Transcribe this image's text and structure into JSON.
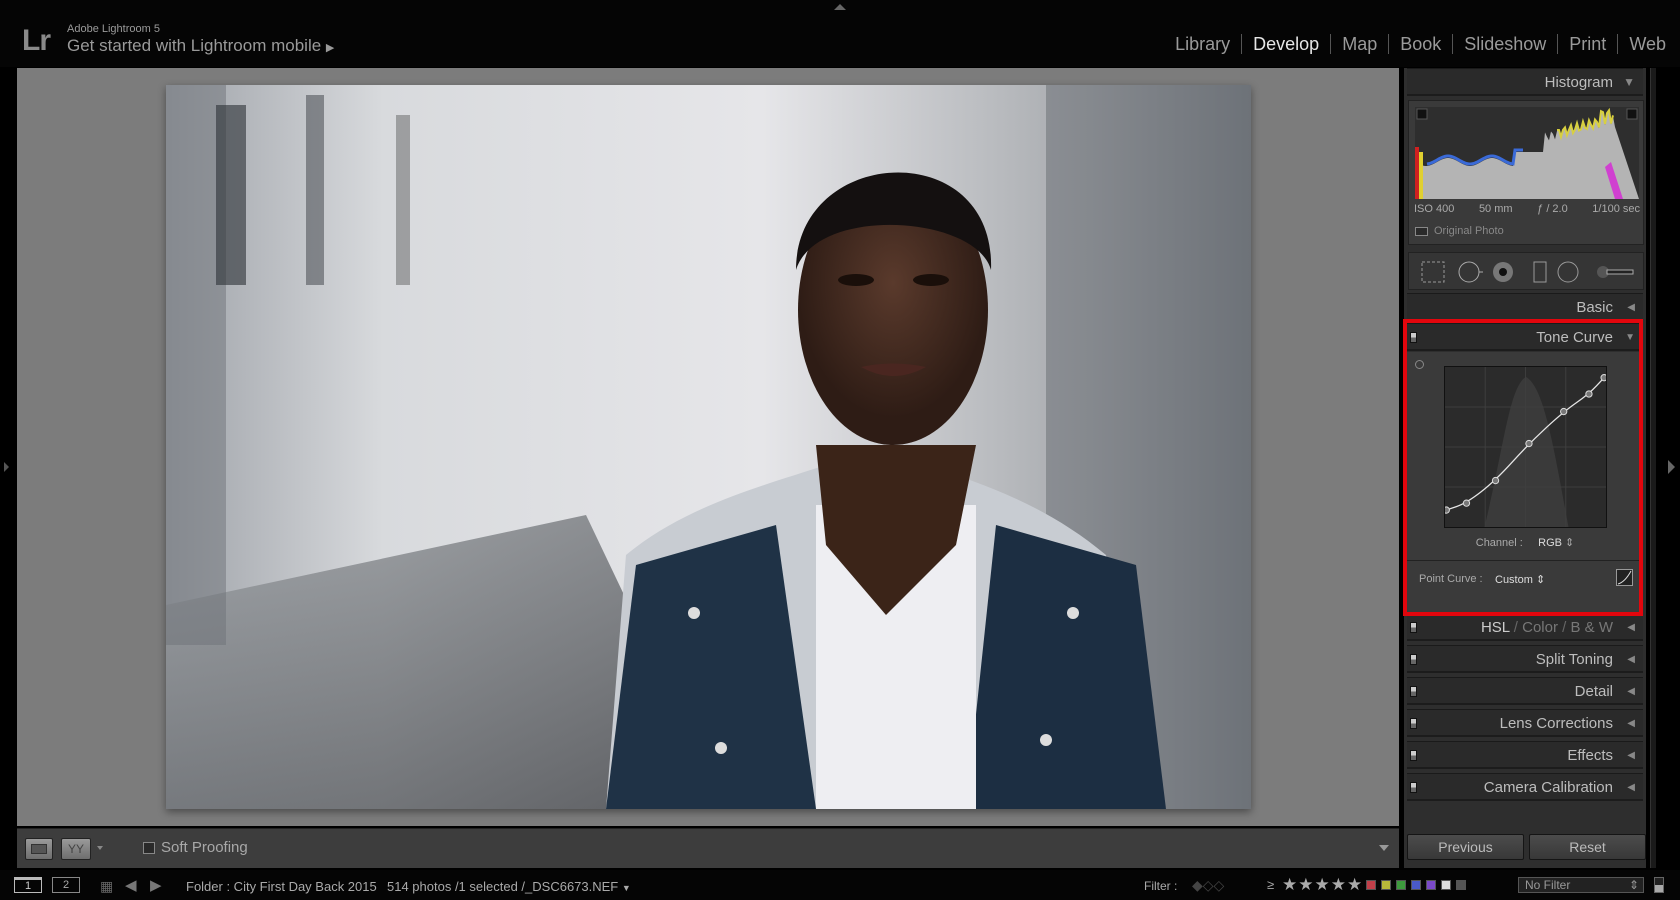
{
  "app": {
    "logo": "Lr",
    "title": "Adobe Lightroom 5",
    "mobile_prompt": "Get started with Lightroom mobile",
    "mobile_arrow": "▶"
  },
  "modules": [
    {
      "label": "Library",
      "active": false
    },
    {
      "label": "Develop",
      "active": true
    },
    {
      "label": "Map",
      "active": false
    },
    {
      "label": "Book",
      "active": false
    },
    {
      "label": "Slideshow",
      "active": false
    },
    {
      "label": "Print",
      "active": false
    },
    {
      "label": "Web",
      "active": false
    }
  ],
  "toolbar": {
    "soft_proofing": "Soft Proofing",
    "soft_proofing_checked": false
  },
  "right_panel": {
    "histogram": {
      "title": "Histogram",
      "iso": "ISO 400",
      "focal": "50 mm",
      "aperture": "ƒ / 2.0",
      "shutter": "1/100 sec",
      "original_photo": "Original Photo"
    },
    "tools": [
      "crop-overlay-icon",
      "spot-removal-icon",
      "red-eye-icon",
      "graduated-filter-icon",
      "radial-filter-icon",
      "adjustment-brush-icon"
    ],
    "basic": "Basic",
    "tone_curve": {
      "title": "Tone Curve",
      "channel_label": "Channel :",
      "channel_value": "RGB",
      "point_curve_label": "Point Curve :",
      "point_curve_value": "Custom",
      "highlighted": true,
      "highlight_color": "#e3060d",
      "points": [
        [
          2,
          27
        ],
        [
          34,
          38
        ],
        [
          80,
          74
        ],
        [
          133,
          133
        ],
        [
          188,
          184
        ],
        [
          228,
          212
        ],
        [
          252,
          238
        ]
      ]
    },
    "hsl": {
      "hsl": "HSL",
      "color": "Color",
      "bw": "B & W",
      "sep": "/"
    },
    "sections": [
      "Split Toning",
      "Detail",
      "Lens Corrections",
      "Effects",
      "Camera Calibration"
    ],
    "previous": "Previous",
    "reset": "Reset"
  },
  "filmstrip": {
    "page1": "1",
    "page2": "2",
    "folder": "Folder : City First Day Back 2015",
    "count": "514 photos /1 selected /_DSC6673.NEF",
    "filter_label": "Filter :",
    "rating_op": "≥",
    "stars": 5,
    "color_labels": [
      "#c0404a",
      "#b8b83a",
      "#3e9a3e",
      "#4a5ac8",
      "#7a4ac8",
      "#dddddd",
      "#555555"
    ],
    "filter_value": "No Filter"
  }
}
